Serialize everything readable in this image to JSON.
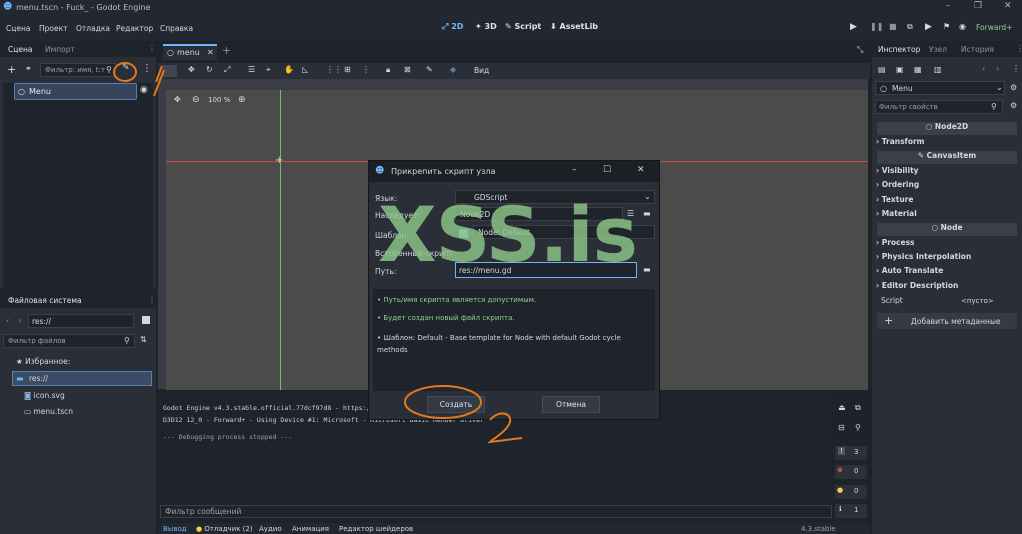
{
  "window": {
    "title": "menu.tscn - Fuck_ - Godot Engine",
    "min": "–",
    "restore": "❐",
    "close": "✕"
  },
  "menu": [
    "Сцена",
    "Проект",
    "Отладка",
    "Редактор",
    "Справка"
  ],
  "modes": {
    "twod": "2D",
    "threed": "3D",
    "script": "Script",
    "assetlib": "AssetLib"
  },
  "renderer": "Forward+",
  "scene_panel": {
    "tabs": [
      "Сцена",
      "Импорт"
    ],
    "filter_placeholder": "Фильтр: имя, t:т",
    "root_node": "Menu"
  },
  "filesystem": {
    "tab": "Файловая система",
    "path": "res://",
    "filter_placeholder": "Фильтр файлов",
    "items": [
      {
        "label": "Избранное:",
        "icon": "star-icon"
      },
      {
        "label": "res://",
        "icon": "folder-icon"
      },
      {
        "label": "icon.svg",
        "icon": "image-icon"
      },
      {
        "label": "menu.tscn",
        "icon": "scene-icon"
      }
    ]
  },
  "editor": {
    "tab": "menu",
    "view_label": "Вид",
    "zoom": "100 %"
  },
  "dialog": {
    "title": "Прикрепить скрипт узла",
    "language_label": "Язык:",
    "language_value": "GDScript",
    "inherits_label": "Наследует:",
    "inherits_value": "Node2D",
    "template_label": "Шаблон:",
    "template_value": "Node: Default",
    "builtin_label": "Встроенный скрипт:",
    "path_label": "Путь:",
    "path_value": "res://menu.gd",
    "msg1": "• Путь/имя скрипта является допустимым.",
    "msg2": "• Будет создан новый файл скрипта.",
    "msg3": "• Шаблон: Default - Base template for Node with default Godot cycle methods",
    "create": "Создать",
    "cancel": "Отмена"
  },
  "console": {
    "line1": "Godot Engine v4.3.stable.official.77dcf97d8 - https://godotengine.org",
    "line2": "D3D12 12_0 - Forward+ - Using Device #1: Microsoft - Microsoft Basic Render Driver",
    "line3": "--- Debugging process stopped ---",
    "filter_placeholder": "Фильтр сообщений",
    "counts": [
      "3",
      "0",
      "0",
      "1"
    ]
  },
  "bottom_tabs": [
    "Вывод",
    "Отладчик (2)",
    "Аудио",
    "Анимация",
    "Редактор шейдеров"
  ],
  "version": "4.3.stable",
  "inspector": {
    "tabs": [
      "Инспектор",
      "Узел",
      "История"
    ],
    "node": "Menu",
    "filter_placeholder": "Фильтр свойств",
    "node2d": "Node2D",
    "transform": "Transform",
    "canvasitem": "CanvasItem",
    "visibility": "Visibility",
    "ordering": "Ordering",
    "texture": "Texture",
    "material": "Material",
    "node_header": "Node",
    "process": "Process",
    "physics": "Physics Interpolation",
    "auto_translate": "Auto Translate",
    "editor_desc": "Editor Description",
    "script_label": "Script",
    "script_value": "<пусто>",
    "add_meta": "Добавить метаданные"
  },
  "watermark": "XSS.is",
  "annotations": {
    "one": "1",
    "two": "2"
  },
  "colors": {
    "accent": "#6bb7ff",
    "success": "#8fd18b",
    "annotation": "#e3791e"
  }
}
